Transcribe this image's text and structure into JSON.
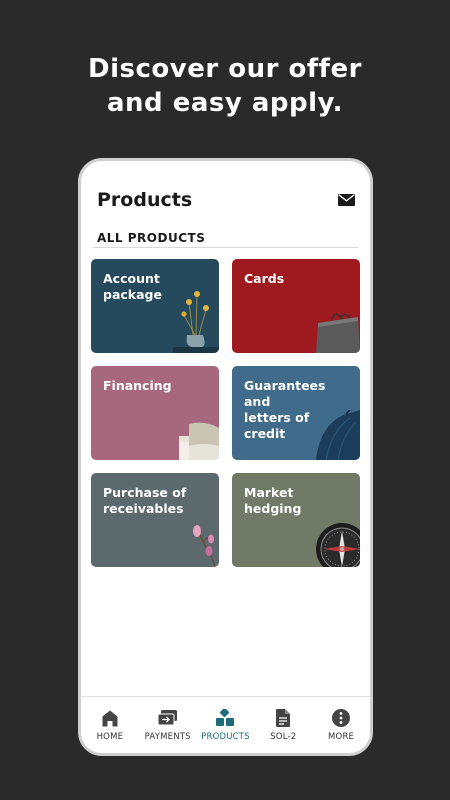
{
  "promo": {
    "line1": "Discover our offer",
    "line2": "and easy apply."
  },
  "header": {
    "title": "Products",
    "mail_icon": "mail-icon"
  },
  "section": {
    "label": "ALL PRODUCTS"
  },
  "tiles": [
    {
      "label": "Account\npackage",
      "color": "#254a5e",
      "art": "vase-icon"
    },
    {
      "label": "Cards",
      "color": "#9e1a1e",
      "art": "shopping-bag-icon"
    },
    {
      "label": "Financing",
      "color": "#a7687e",
      "art": "sofa-icon"
    },
    {
      "label": "Guarantees and\nletters of credit",
      "color": "#416b8b",
      "art": "umbrella-icon"
    },
    {
      "label": "Purchase of\nreceivables",
      "color": "#5c6a6e",
      "art": "flower-branch-icon"
    },
    {
      "label": "Market\nhedging",
      "color": "#707a66",
      "art": "compass-icon"
    }
  ],
  "nav": {
    "accent": "#1f6c7a",
    "items": [
      {
        "label": "HOME",
        "icon": "home-icon"
      },
      {
        "label": "PAYMENTS",
        "icon": "payments-icon"
      },
      {
        "label": "PRODUCTS",
        "icon": "products-icon",
        "active": true
      },
      {
        "label": "SOL-2",
        "icon": "document-icon"
      },
      {
        "label": "MORE",
        "icon": "more-icon"
      }
    ]
  }
}
